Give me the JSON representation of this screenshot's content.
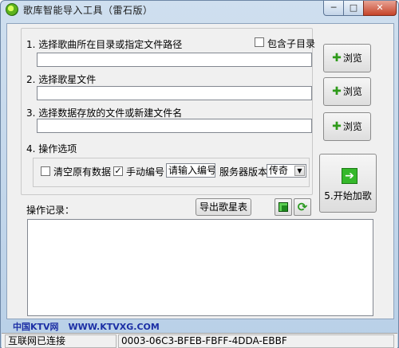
{
  "window": {
    "title": "歌库智能导入工具（雷石版）",
    "controls": {
      "minimize": "─",
      "maximize": "□",
      "close": "✕"
    }
  },
  "step1": {
    "label": "1. 选择歌曲所在目录或指定文件路径",
    "include_subdirs_label": "包含子目录",
    "include_subdirs_checked": false,
    "path_value": ""
  },
  "step2": {
    "label": "2. 选择歌星文件",
    "path_value": ""
  },
  "step3": {
    "label": "3. 选择数据存放的文件或新建文件名",
    "path_value": ""
  },
  "browse": {
    "label": "浏览",
    "icon": "plus-icon",
    "icon_glyph": "✚"
  },
  "step4": {
    "label": "4. 操作选项",
    "clear_data_label": "清空原有数据",
    "clear_data_checked": false,
    "manual_number_label": "手动编号",
    "manual_number_checked": true,
    "check_glyph": "✓",
    "number_input_value": "请输入编号",
    "server_version_label": "服务器版本",
    "server_version_selected": "传奇"
  },
  "start": {
    "label": "5.开始加歌",
    "icon": "arrow-right-icon",
    "icon_glyph": "➔"
  },
  "log": {
    "label": "操作记录：",
    "export_label": "导出歌星表",
    "content": ""
  },
  "icons": {
    "cube": "cube-icon",
    "refresh": "refresh-icon",
    "refresh_glyph": "⟳"
  },
  "footer": {
    "brand": "中国KTV网",
    "url": "WWW.KTVXG.COM"
  },
  "status": {
    "connection": "互联网已连接",
    "machine_id": "0003-06C3-BFEB-FBFF-4DDA-EBBF"
  },
  "colors": {
    "accent_green": "#35b82b",
    "footer_blue": "#1c2fa5",
    "title_bg": "#cfdfef"
  }
}
